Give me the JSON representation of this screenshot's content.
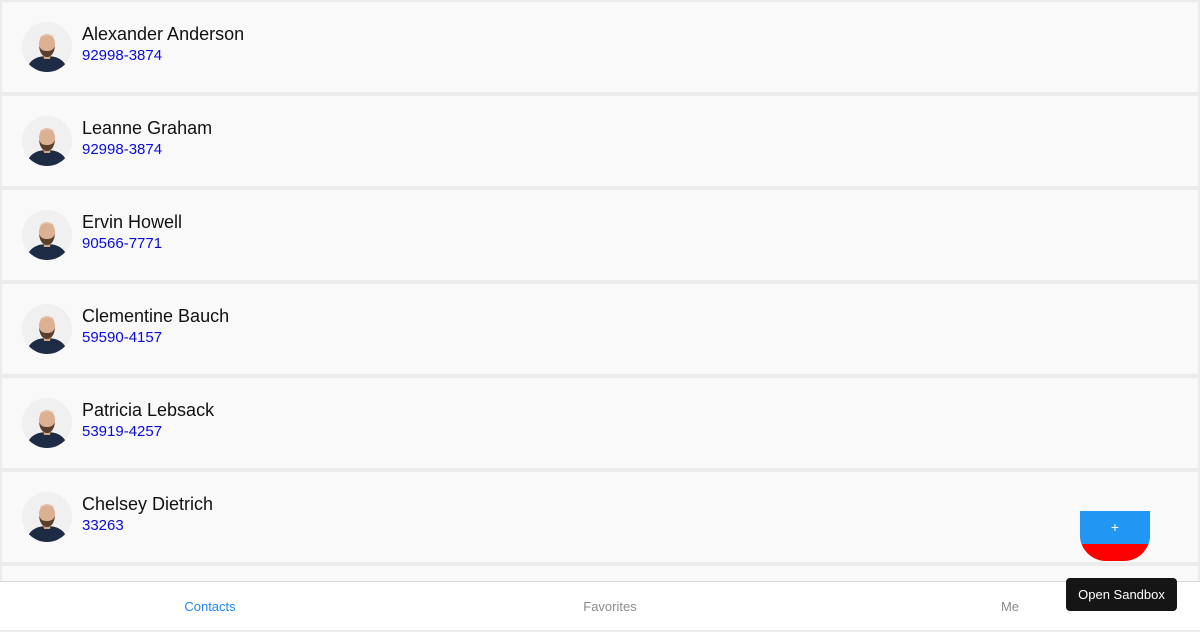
{
  "contacts": [
    {
      "name": "Alexander Anderson",
      "phone": "92998-3874"
    },
    {
      "name": "Leanne Graham",
      "phone": "92998-3874"
    },
    {
      "name": "Ervin Howell",
      "phone": "90566-7771"
    },
    {
      "name": "Clementine Bauch",
      "phone": "59590-4157"
    },
    {
      "name": "Patricia Lebsack",
      "phone": "53919-4257"
    },
    {
      "name": "Chelsey Dietrich",
      "phone": "33263"
    }
  ],
  "fab": {
    "label": "+"
  },
  "nav": {
    "tabs": [
      {
        "label": "Contacts",
        "active": true
      },
      {
        "label": "Favorites",
        "active": false
      },
      {
        "label": "Me",
        "active": false
      }
    ]
  },
  "sandbox": {
    "label": "Open Sandbox"
  },
  "colors": {
    "accent": "#1f86f0",
    "phone_link": "#0a0ad8",
    "fab_top": "#2196f3",
    "fab_bottom": "#ff0000"
  }
}
